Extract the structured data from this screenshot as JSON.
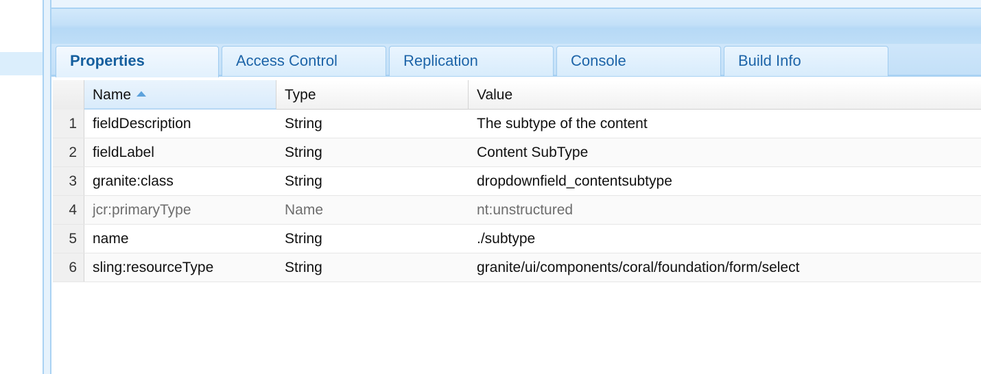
{
  "tabs": [
    {
      "label": "Properties",
      "active": true
    },
    {
      "label": "Access Control",
      "active": false
    },
    {
      "label": "Replication",
      "active": false
    },
    {
      "label": "Console",
      "active": false
    },
    {
      "label": "Build Info",
      "active": false
    }
  ],
  "table": {
    "columns": [
      "Name",
      "Type",
      "Value"
    ],
    "sort": {
      "column": "Name",
      "direction": "ascending"
    },
    "rows": [
      {
        "num": "1",
        "name": "fieldDescription",
        "type": "String",
        "value": "The subtype of the content"
      },
      {
        "num": "2",
        "name": "fieldLabel",
        "type": "String",
        "value": "Content SubType"
      },
      {
        "num": "3",
        "name": "granite:class",
        "type": "String",
        "value": "dropdownfield_contentsubtype"
      },
      {
        "num": "4",
        "name": "jcr:primaryType",
        "type": "Name",
        "value": "nt:unstructured",
        "muted": true
      },
      {
        "num": "5",
        "name": "name",
        "type": "String",
        "value": "./subtype"
      },
      {
        "num": "6",
        "name": "sling:resourceType",
        "type": "String",
        "value": "granite/ui/components/coral/foundation/form/select"
      }
    ]
  },
  "colors": {
    "accent": "#1d64a8",
    "header_blue": "#c3e0f8",
    "border_blue": "#a9d2f3"
  }
}
